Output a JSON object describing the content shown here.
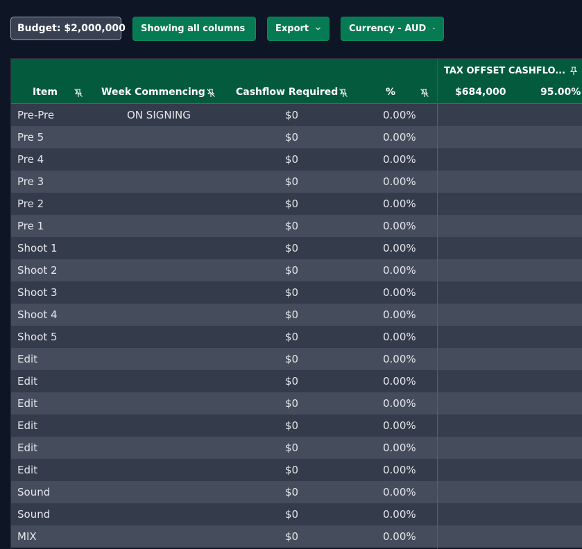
{
  "toolbar": {
    "budget_label": "Budget: $2,000,000",
    "columns_label": "Showing all columns",
    "export_label": "Export",
    "currency_label": "Currency - AUD"
  },
  "header": {
    "item": "Item",
    "week_commencing": "Week Commencing",
    "cashflow_required": "Cashflow Required",
    "percent": "%",
    "tax_offset_title": "TAX OFFSET CASHFLO...",
    "tax_offset_amount": "$684,000",
    "tax_offset_percent": "95.00%"
  },
  "rows": [
    {
      "item": "Pre-Pre",
      "week": "ON SIGNING",
      "cashflow": "$0",
      "percent": "0.00%"
    },
    {
      "item": "Pre 5",
      "week": "",
      "cashflow": "$0",
      "percent": "0.00%"
    },
    {
      "item": "Pre 4",
      "week": "",
      "cashflow": "$0",
      "percent": "0.00%"
    },
    {
      "item": "Pre 3",
      "week": "",
      "cashflow": "$0",
      "percent": "0.00%"
    },
    {
      "item": "Pre 2",
      "week": "",
      "cashflow": "$0",
      "percent": "0.00%"
    },
    {
      "item": "Pre 1",
      "week": "",
      "cashflow": "$0",
      "percent": "0.00%"
    },
    {
      "item": "Shoot 1",
      "week": "",
      "cashflow": "$0",
      "percent": "0.00%"
    },
    {
      "item": "Shoot 2",
      "week": "",
      "cashflow": "$0",
      "percent": "0.00%"
    },
    {
      "item": "Shoot 3",
      "week": "",
      "cashflow": "$0",
      "percent": "0.00%"
    },
    {
      "item": "Shoot 4",
      "week": "",
      "cashflow": "$0",
      "percent": "0.00%"
    },
    {
      "item": "Shoot 5",
      "week": "",
      "cashflow": "$0",
      "percent": "0.00%"
    },
    {
      "item": "Edit",
      "week": "",
      "cashflow": "$0",
      "percent": "0.00%"
    },
    {
      "item": "Edit",
      "week": "",
      "cashflow": "$0",
      "percent": "0.00%"
    },
    {
      "item": "Edit",
      "week": "",
      "cashflow": "$0",
      "percent": "0.00%"
    },
    {
      "item": "Edit",
      "week": "",
      "cashflow": "$0",
      "percent": "0.00%"
    },
    {
      "item": "Edit",
      "week": "",
      "cashflow": "$0",
      "percent": "0.00%"
    },
    {
      "item": "Edit",
      "week": "",
      "cashflow": "$0",
      "percent": "0.00%"
    },
    {
      "item": "Sound",
      "week": "",
      "cashflow": "$0",
      "percent": "0.00%"
    },
    {
      "item": "Sound",
      "week": "",
      "cashflow": "$0",
      "percent": "0.00%"
    },
    {
      "item": "MIX",
      "week": "",
      "cashflow": "$0",
      "percent": "0.00%"
    }
  ],
  "icons": {
    "chevron": "chevron-down-icon",
    "unpin": "unpin-icon",
    "pin": "pin-icon"
  }
}
